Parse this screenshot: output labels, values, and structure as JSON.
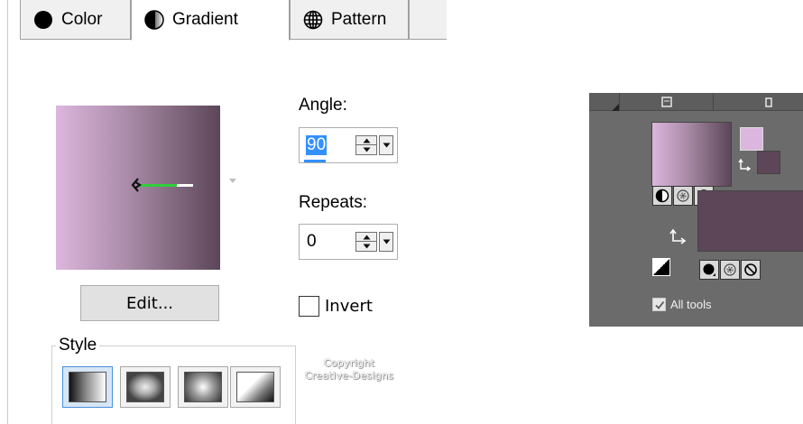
{
  "dialog": {
    "tabs": [
      {
        "label": "Color",
        "icon": "filled-circle-icon",
        "active": false
      },
      {
        "label": "Gradient",
        "icon": "half-circle-icon",
        "active": true
      },
      {
        "label": "Pattern",
        "icon": "globe-grid-icon",
        "active": false
      }
    ],
    "gradient_colors": {
      "start": "#dcb6de",
      "end": "#5c4658"
    },
    "angle": {
      "label": "Angle:",
      "value": "90"
    },
    "repeats": {
      "label": "Repeats:",
      "value": "0"
    },
    "edit_label": "Edit...",
    "invert": {
      "label": "Invert",
      "checked": false
    },
    "style": {
      "legend": "Style",
      "options": [
        {
          "name": "linear-gradient-style",
          "selected": true
        },
        {
          "name": "rectangular-gradient-style",
          "selected": false
        },
        {
          "name": "radial-gradient-style",
          "selected": false
        },
        {
          "name": "corner-gradient-style",
          "selected": false
        }
      ]
    },
    "watermark": {
      "line1": "Copyright",
      "line2": "Creative-Designs"
    }
  },
  "materials_panel": {
    "background_color": "#6b6b6b",
    "foreground_color": "#dcb6de",
    "background_swatch_color": "#5c4658",
    "fg_icons": [
      "gradient-icon",
      "pattern-icon",
      "none-icon"
    ],
    "bg_icons": [
      "color-icon",
      "pattern-icon",
      "none-icon"
    ],
    "all_tools": {
      "label": "All tools",
      "checked": true
    }
  }
}
